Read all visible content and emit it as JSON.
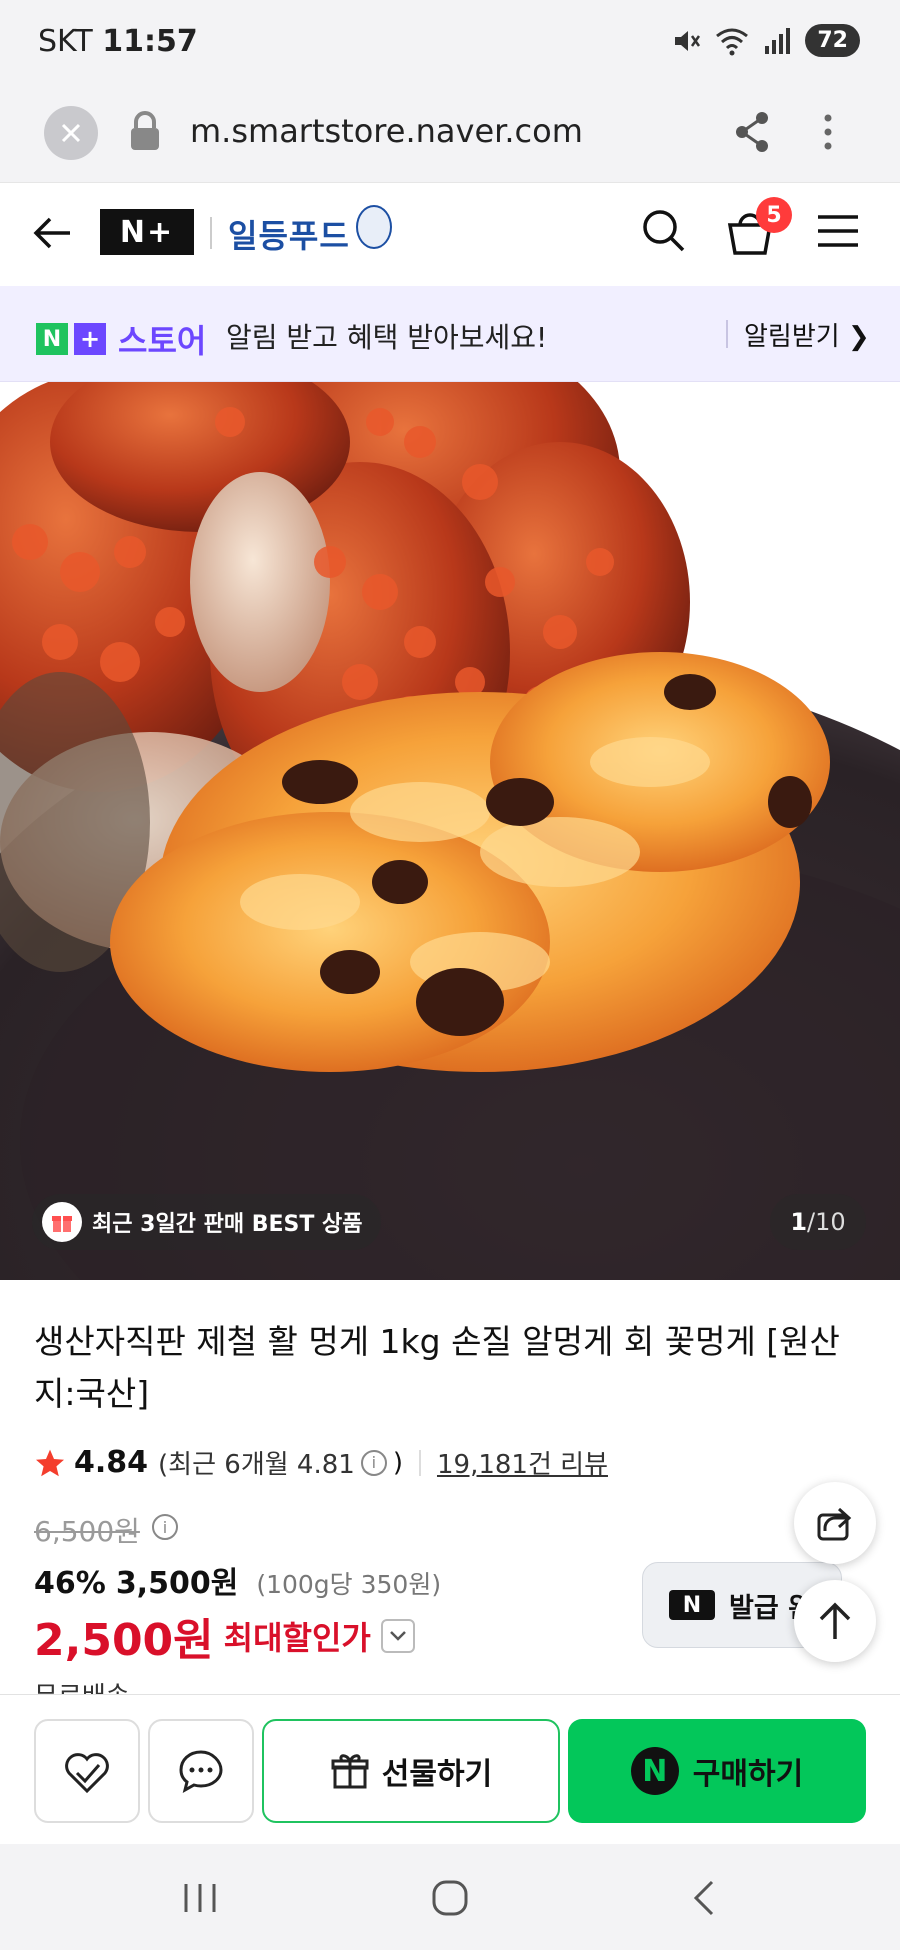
{
  "status_bar": {
    "carrier": "SKT",
    "time": "11:57",
    "battery": "72"
  },
  "browser": {
    "url": "m.smartstore.naver.com"
  },
  "header": {
    "np_logo": "N+",
    "brand": "일등푸드",
    "cart_count": "5"
  },
  "notice": {
    "store_n": "N",
    "store_plus": "+",
    "store_label": "스토어",
    "message": "알림 받고 혜택 받아보세요!",
    "action": "알림받기 ❯"
  },
  "gallery": {
    "badge": "최근 3일간 판매 BEST 상품",
    "current": "1",
    "total": "/10"
  },
  "product": {
    "title": "생산자직판 제철 활 멍게 1kg 손질 알멍게 회 꽃멍게 [원산지:국산]",
    "rating": "4.84",
    "recent_rating": "(최근 6개월 4.81",
    "recent_close": ")",
    "reviews": "19,181건 리뷰",
    "original_price": "6,500원",
    "discount_pct": "46%",
    "discount_price": "3,500원",
    "unit_price": "(100g당 350원)",
    "max_price": "2,500원",
    "max_label": "최대할인가",
    "shipping": "무료배송"
  },
  "coupon": {
    "label": "발급 완"
  },
  "actions": {
    "gift": "선물하기",
    "buy": "구매하기"
  },
  "colors": {
    "naver_green": "#03c75a",
    "sale_red": "#d9102a",
    "store_purple": "#6c47ff"
  }
}
